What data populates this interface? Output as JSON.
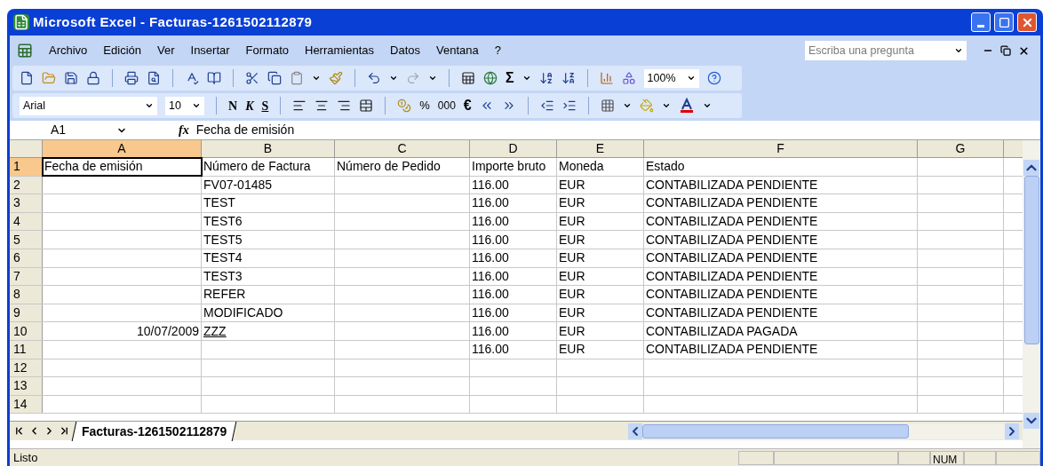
{
  "window": {
    "title": "Microsoft Excel - Facturas-1261502112879"
  },
  "menu": {
    "items": [
      {
        "label": "Archivo"
      },
      {
        "label": "Edición"
      },
      {
        "label": "Ver"
      },
      {
        "label": "Insertar"
      },
      {
        "label": "Formato"
      },
      {
        "label": "Herramientas"
      },
      {
        "label": "Datos"
      },
      {
        "label": "Ventana"
      },
      {
        "label": "?"
      }
    ],
    "help_field": {
      "placeholder": "Escriba una pregunta"
    }
  },
  "standard_toolbar": {
    "sum": "Σ",
    "zoom": "100%"
  },
  "format_toolbar": {
    "font": "Arial",
    "size": "10",
    "bold": "N",
    "italic": "K",
    "underline": "S",
    "percent": "%",
    "thousands": "000",
    "euro": "€"
  },
  "formula_bar": {
    "name_box": "A1",
    "fx": "fx",
    "value": "Fecha de emisión"
  },
  "sheet": {
    "columns": [
      {
        "label": "A",
        "selected": true
      },
      {
        "label": "B",
        "selected": false
      },
      {
        "label": "C",
        "selected": false
      },
      {
        "label": "D",
        "selected": false
      },
      {
        "label": "E",
        "selected": false
      },
      {
        "label": "F",
        "selected": false
      },
      {
        "label": "G",
        "selected": false
      }
    ],
    "rows": [
      {
        "num": "1",
        "selected": true,
        "cells": [
          {
            "text": "Fecha de emisión",
            "selected": true
          },
          "Número de Factura",
          "Número de Pedido",
          "Importe bruto",
          "Moneda",
          "Estado",
          null
        ]
      },
      {
        "num": "2",
        "selected": false,
        "cells": [
          null,
          "FV07-01485",
          null,
          "116.00",
          "EUR",
          "CONTABILIZADA PENDIENTE",
          null
        ]
      },
      {
        "num": "3",
        "selected": false,
        "cells": [
          null,
          "TEST",
          null,
          "116.00",
          "EUR",
          "CONTABILIZADA PENDIENTE",
          null
        ]
      },
      {
        "num": "4",
        "selected": false,
        "cells": [
          null,
          "TEST6",
          null,
          "116.00",
          "EUR",
          "CONTABILIZADA PENDIENTE",
          null
        ]
      },
      {
        "num": "5",
        "selected": false,
        "cells": [
          null,
          "TEST5",
          null,
          "116.00",
          "EUR",
          "CONTABILIZADA PENDIENTE",
          null
        ]
      },
      {
        "num": "6",
        "selected": false,
        "cells": [
          null,
          "TEST4",
          null,
          "116.00",
          "EUR",
          "CONTABILIZADA PENDIENTE",
          null
        ]
      },
      {
        "num": "7",
        "selected": false,
        "cells": [
          null,
          "TEST3",
          null,
          "116.00",
          "EUR",
          "CONTABILIZADA PENDIENTE",
          null
        ]
      },
      {
        "num": "8",
        "selected": false,
        "cells": [
          null,
          "REFER",
          null,
          "116.00",
          "EUR",
          "CONTABILIZADA PENDIENTE",
          null
        ]
      },
      {
        "num": "9",
        "selected": false,
        "cells": [
          null,
          "MODIFICADO",
          null,
          "116.00",
          "EUR",
          "CONTABILIZADA PENDIENTE",
          null
        ]
      },
      {
        "num": "10",
        "selected": false,
        "cells": [
          {
            "text": "10/07/2009",
            "kind": "date"
          },
          {
            "text": "ZZZ",
            "kind": "link"
          },
          null,
          "116.00",
          "EUR",
          "CONTABILIZADA PAGADA",
          null
        ]
      },
      {
        "num": "11",
        "selected": false,
        "cells": [
          null,
          null,
          null,
          "116.00",
          "EUR",
          "CONTABILIZADA PENDIENTE",
          null
        ]
      },
      {
        "num": "12",
        "selected": false,
        "cells": [
          null,
          null,
          null,
          null,
          null,
          null,
          null
        ]
      },
      {
        "num": "13",
        "selected": false,
        "cells": [
          null,
          null,
          null,
          null,
          null,
          null,
          null
        ]
      },
      {
        "num": "14",
        "selected": false,
        "cells": [
          null,
          null,
          null,
          null,
          null,
          null,
          null
        ]
      }
    ]
  },
  "sheet_tabs": [
    {
      "label": "Facturas-1261502112879",
      "selected": true
    }
  ],
  "status_bar": {
    "text": "Listo",
    "indicator": "NUM"
  }
}
